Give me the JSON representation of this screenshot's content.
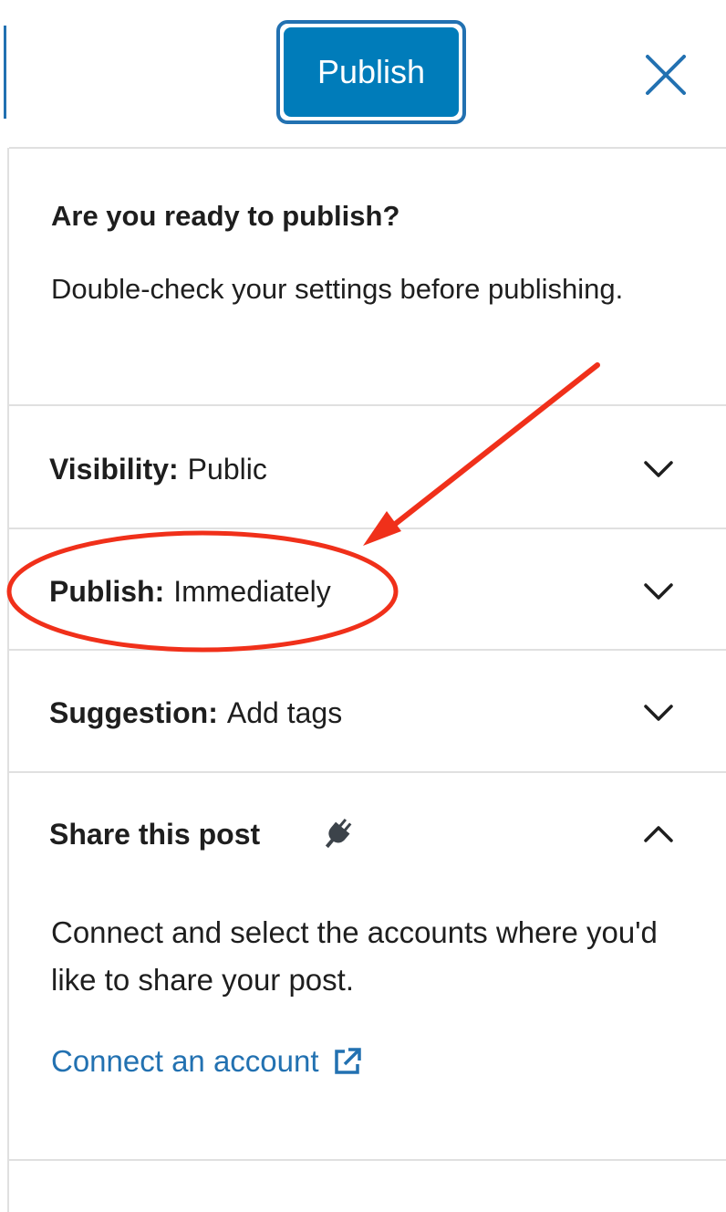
{
  "header": {
    "publish_button_label": "Publish",
    "close_icon": "close-icon",
    "accent_color": "#2271b1",
    "button_color": "#007cba"
  },
  "intro": {
    "title": "Are you ready to publish?",
    "description": "Double-check your settings before publishing."
  },
  "panels": [
    {
      "key": "Visibility:",
      "value": "Public",
      "icon": "chevron-down-icon"
    },
    {
      "key": "Publish:",
      "value": "Immediately",
      "icon": "chevron-down-icon"
    },
    {
      "key": "Suggestion:",
      "value": "Add tags",
      "icon": "chevron-down-icon"
    }
  ],
  "share": {
    "title": "Share this post",
    "icon": "plug-icon",
    "toggle_icon": "chevron-up-icon",
    "description": "Connect and select the accounts where you'd like to share your post.",
    "link_label": "Connect an account",
    "link_icon": "external-link-icon",
    "link_color": "#2271b1"
  },
  "annotation": {
    "color": "#f0301a",
    "shapes": [
      "arrow",
      "ellipse"
    ]
  }
}
